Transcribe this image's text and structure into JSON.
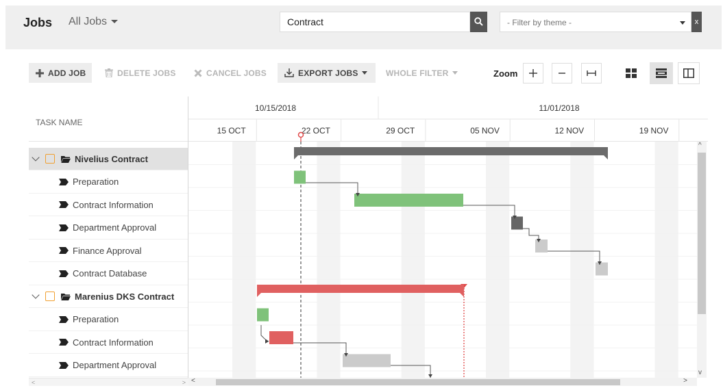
{
  "header": {
    "title": "Jobs",
    "view_selector": "All Jobs",
    "search_value": "Contract",
    "theme_filter_placeholder": "- Filter by theme -",
    "theme_clear_label": "x"
  },
  "toolbar": {
    "add_job": "ADD JOB",
    "delete_jobs": "DELETE JOBS",
    "cancel_jobs": "CANCEL JOBS",
    "export_jobs": "EXPORT JOBS",
    "whole_filter": "WHOLE FILTER",
    "zoom_label": "Zoom"
  },
  "grid": {
    "column_header": "TASK NAME",
    "rows": [
      {
        "label": "Nivelius Contract",
        "type": "group",
        "expanded": true,
        "selected": true
      },
      {
        "label": "Preparation",
        "type": "task"
      },
      {
        "label": "Contract Information",
        "type": "task"
      },
      {
        "label": "Department Approval",
        "type": "task"
      },
      {
        "label": "Finance Approval",
        "type": "task"
      },
      {
        "label": "Contract Database",
        "type": "task"
      },
      {
        "label": "Marenius DKS Contract",
        "type": "group",
        "expanded": true,
        "selected": false
      },
      {
        "label": "Preparation",
        "type": "task"
      },
      {
        "label": "Contract Information",
        "type": "task"
      },
      {
        "label": "Department Approval",
        "type": "task"
      }
    ]
  },
  "timeline": {
    "periods": [
      "10/15/2018",
      "11/01/2018"
    ],
    "weeks": [
      "15 OCT",
      "22 OCT",
      "29 OCT",
      "05 NOV",
      "12 NOV",
      "19 NOV"
    ],
    "today": "2018-10-22"
  },
  "gantt": {
    "colors": {
      "summary_dark": "#6b6b6b",
      "summary_red": "#e06060",
      "green": "#7fc27a",
      "red": "#e06060",
      "dark": "#666666",
      "light": "#cbcbcb",
      "today_line": "#555555",
      "deadline_line": "#e04848"
    }
  }
}
